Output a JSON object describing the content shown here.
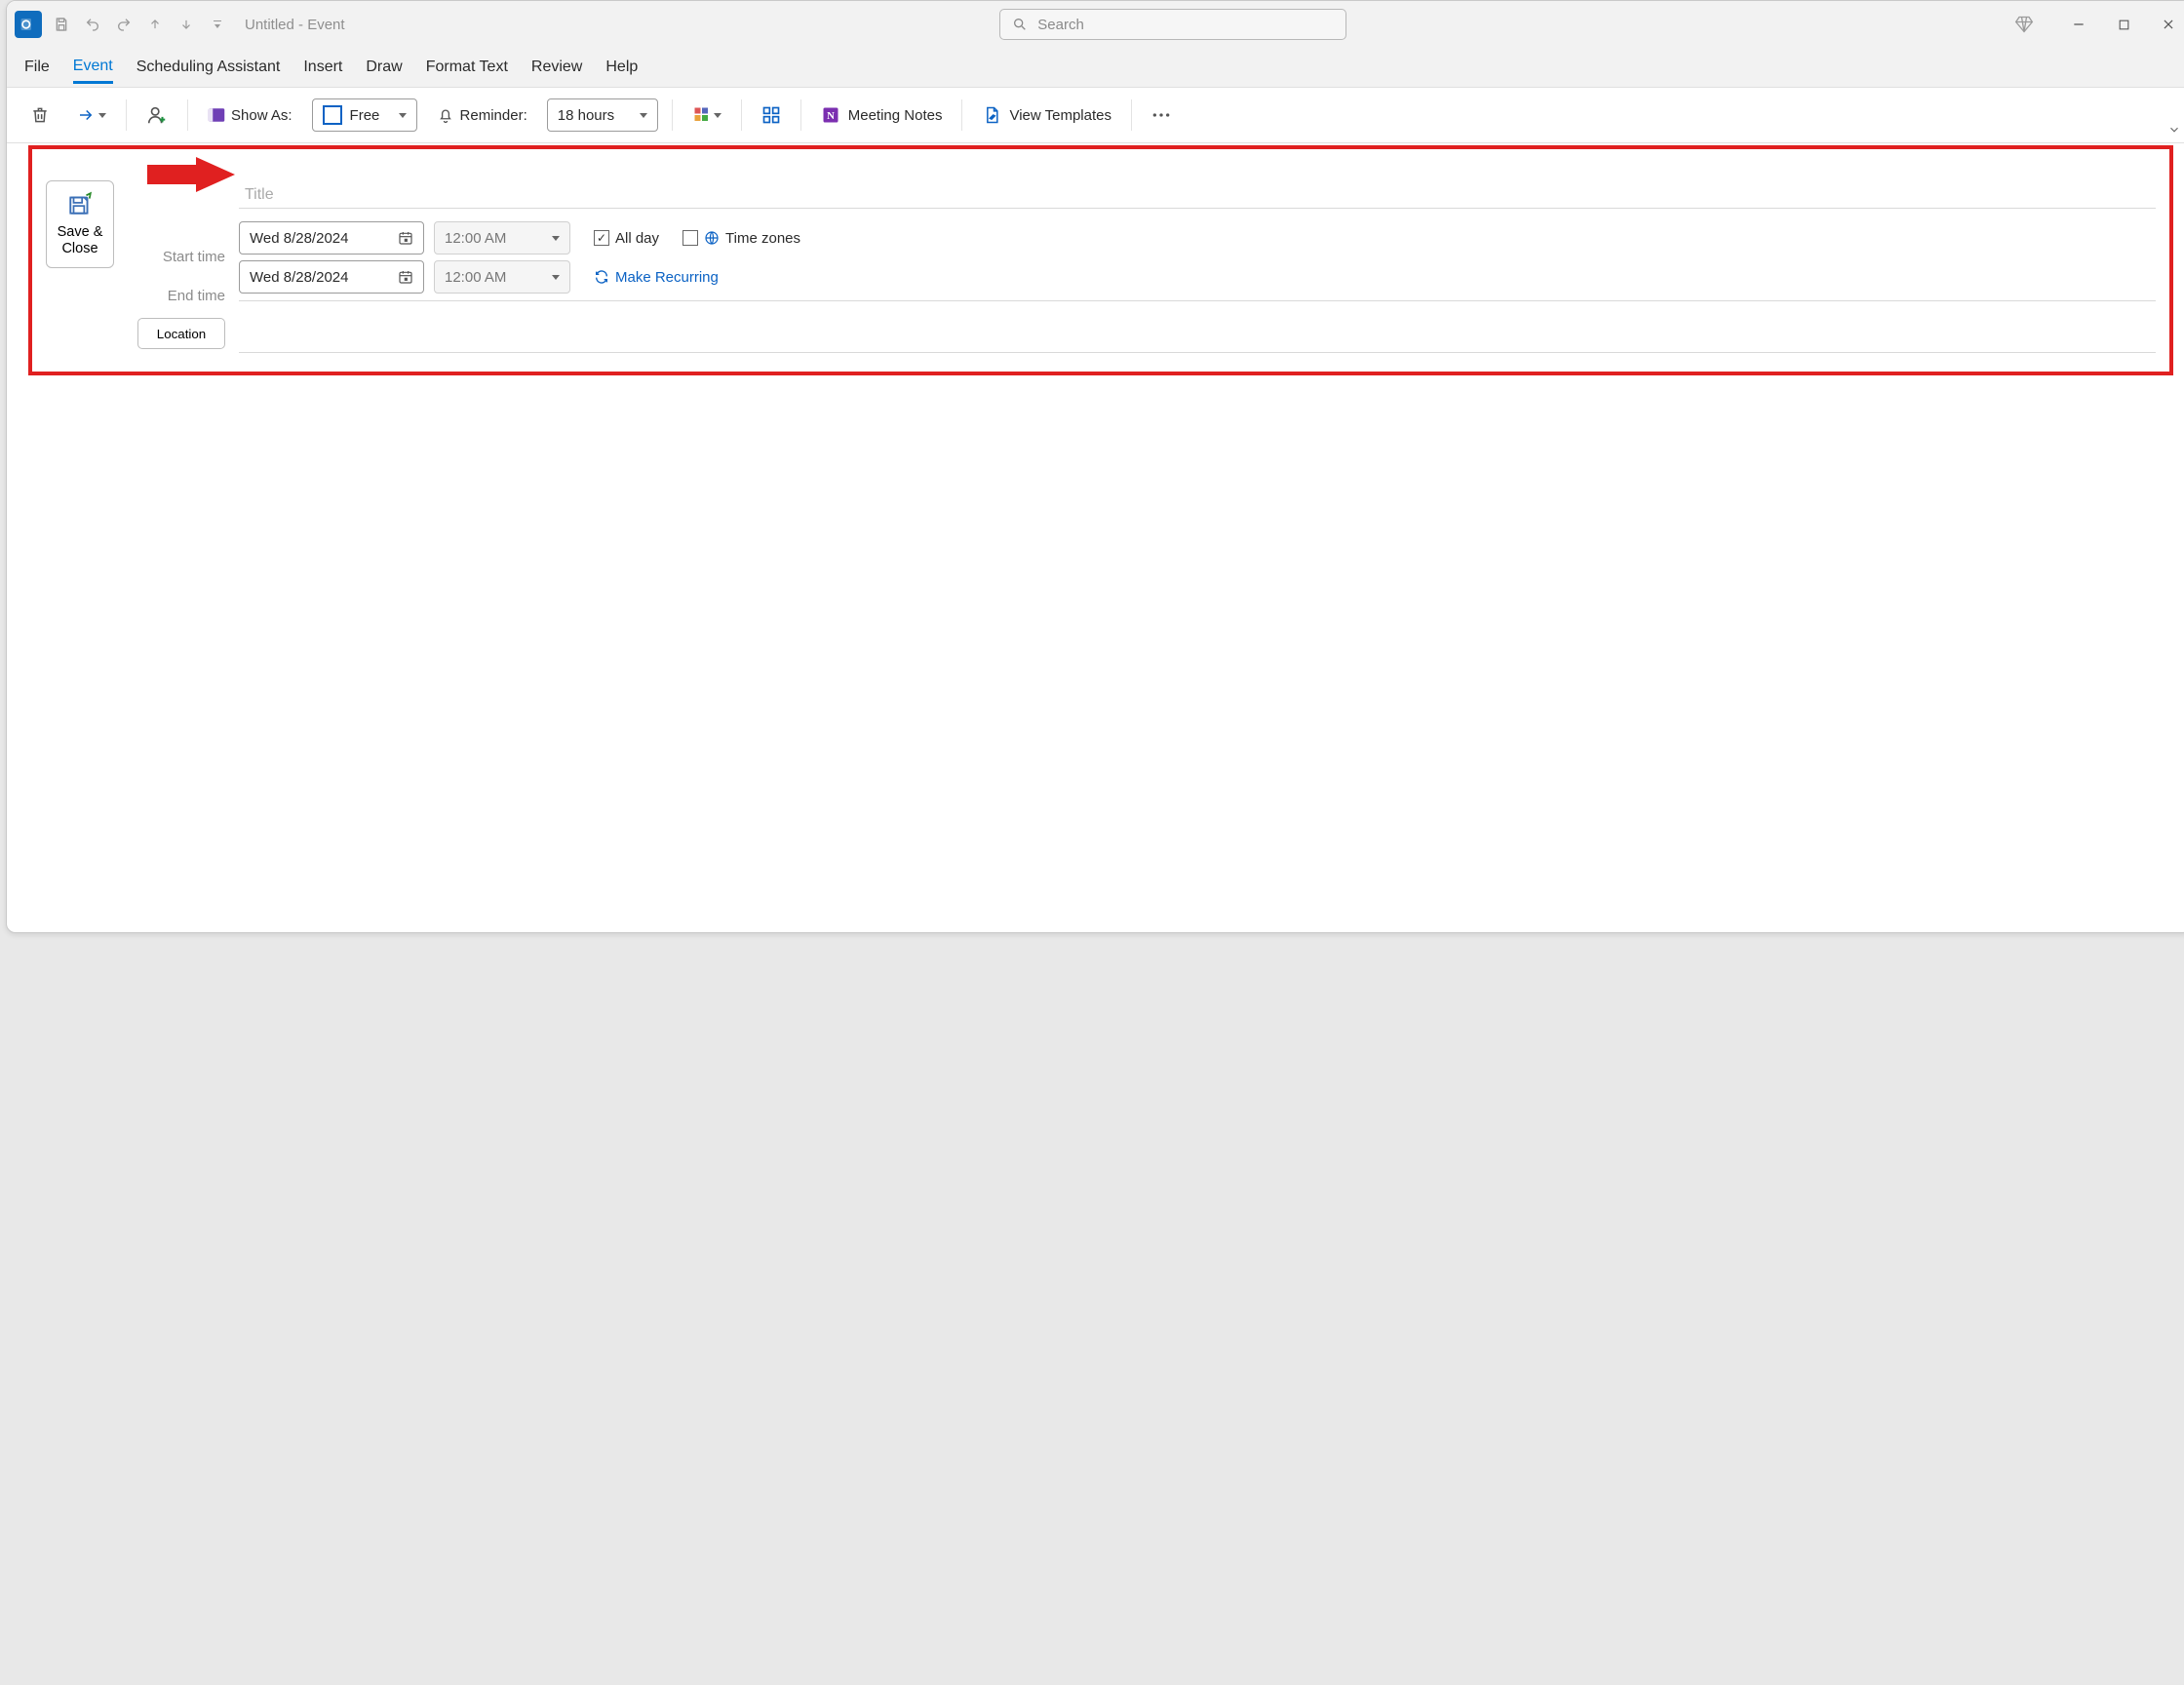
{
  "window": {
    "title": "Untitled  -  Event",
    "search_placeholder": "Search"
  },
  "tabs": {
    "file": "File",
    "event": "Event",
    "scheduling": "Scheduling Assistant",
    "insert": "Insert",
    "draw": "Draw",
    "format": "Format Text",
    "review": "Review",
    "help": "Help"
  },
  "ribbon": {
    "show_as_label": "Show As:",
    "show_as_value": "Free",
    "reminder_label": "Reminder:",
    "reminder_value": "18 hours",
    "meeting_notes": "Meeting Notes",
    "view_templates": "View Templates"
  },
  "form": {
    "save_close_l1": "Save &",
    "save_close_l2": "Close",
    "title_placeholder": "Title",
    "start_label": "Start time",
    "end_label": "End time",
    "start_date": "Wed 8/28/2024",
    "start_time": "12:00 AM",
    "end_date": "Wed 8/28/2024",
    "end_time": "12:00 AM",
    "all_day_label": "All day",
    "all_day_checked": true,
    "timezones_label": "Time zones",
    "recurring_label": "Make Recurring",
    "location_label": "Location"
  }
}
